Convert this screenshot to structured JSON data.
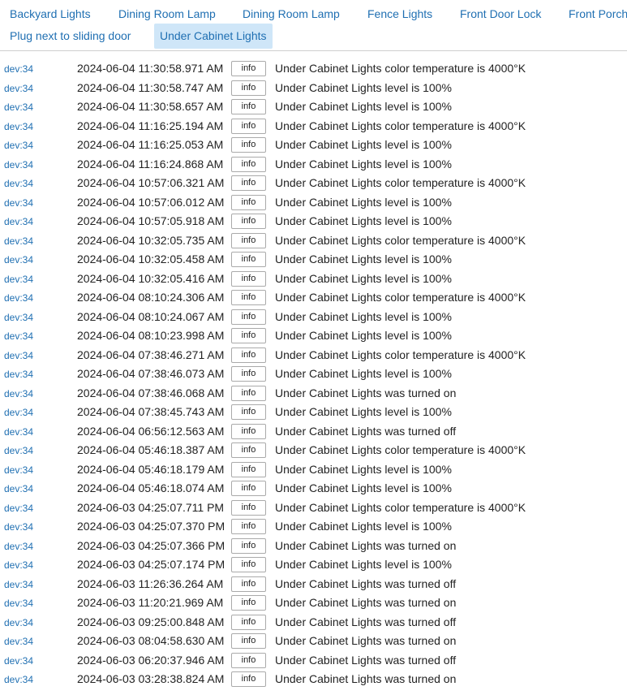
{
  "tabs": [
    {
      "label": "Backyard Lights",
      "active": false
    },
    {
      "label": "Dining Room Lamp",
      "active": false
    },
    {
      "label": "Dining Room Lamp",
      "active": false
    },
    {
      "label": "Fence Lights",
      "active": false
    },
    {
      "label": "Front Door Lock",
      "active": false
    },
    {
      "label": "Front Porch",
      "active": false
    },
    {
      "label": "Plug next to sliding door",
      "active": false
    },
    {
      "label": "Under Cabinet Lights",
      "active": true
    }
  ],
  "info_label": "info",
  "events": [
    {
      "dev": "dev:34",
      "time": "2024-06-04 11:30:58.971 AM",
      "desc": "Under Cabinet Lights color temperature is 4000°K"
    },
    {
      "dev": "dev:34",
      "time": "2024-06-04 11:30:58.747 AM",
      "desc": "Under Cabinet Lights level is 100%"
    },
    {
      "dev": "dev:34",
      "time": "2024-06-04 11:30:58.657 AM",
      "desc": "Under Cabinet Lights level is 100%"
    },
    {
      "dev": "dev:34",
      "time": "2024-06-04 11:16:25.194 AM",
      "desc": "Under Cabinet Lights color temperature is 4000°K"
    },
    {
      "dev": "dev:34",
      "time": "2024-06-04 11:16:25.053 AM",
      "desc": "Under Cabinet Lights level is 100%"
    },
    {
      "dev": "dev:34",
      "time": "2024-06-04 11:16:24.868 AM",
      "desc": "Under Cabinet Lights level is 100%"
    },
    {
      "dev": "dev:34",
      "time": "2024-06-04 10:57:06.321 AM",
      "desc": "Under Cabinet Lights color temperature is 4000°K"
    },
    {
      "dev": "dev:34",
      "time": "2024-06-04 10:57:06.012 AM",
      "desc": "Under Cabinet Lights level is 100%"
    },
    {
      "dev": "dev:34",
      "time": "2024-06-04 10:57:05.918 AM",
      "desc": "Under Cabinet Lights level is 100%"
    },
    {
      "dev": "dev:34",
      "time": "2024-06-04 10:32:05.735 AM",
      "desc": "Under Cabinet Lights color temperature is 4000°K"
    },
    {
      "dev": "dev:34",
      "time": "2024-06-04 10:32:05.458 AM",
      "desc": "Under Cabinet Lights level is 100%"
    },
    {
      "dev": "dev:34",
      "time": "2024-06-04 10:32:05.416 AM",
      "desc": "Under Cabinet Lights level is 100%"
    },
    {
      "dev": "dev:34",
      "time": "2024-06-04 08:10:24.306 AM",
      "desc": "Under Cabinet Lights color temperature is 4000°K"
    },
    {
      "dev": "dev:34",
      "time": "2024-06-04 08:10:24.067 AM",
      "desc": "Under Cabinet Lights level is 100%"
    },
    {
      "dev": "dev:34",
      "time": "2024-06-04 08:10:23.998 AM",
      "desc": "Under Cabinet Lights level is 100%"
    },
    {
      "dev": "dev:34",
      "time": "2024-06-04 07:38:46.271 AM",
      "desc": "Under Cabinet Lights color temperature is 4000°K"
    },
    {
      "dev": "dev:34",
      "time": "2024-06-04 07:38:46.073 AM",
      "desc": "Under Cabinet Lights level is 100%"
    },
    {
      "dev": "dev:34",
      "time": "2024-06-04 07:38:46.068 AM",
      "desc": "Under Cabinet Lights was turned on"
    },
    {
      "dev": "dev:34",
      "time": "2024-06-04 07:38:45.743 AM",
      "desc": "Under Cabinet Lights level is 100%"
    },
    {
      "dev": "dev:34",
      "time": "2024-06-04 06:56:12.563 AM",
      "desc": "Under Cabinet Lights was turned off"
    },
    {
      "dev": "dev:34",
      "time": "2024-06-04 05:46:18.387 AM",
      "desc": "Under Cabinet Lights color temperature is 4000°K"
    },
    {
      "dev": "dev:34",
      "time": "2024-06-04 05:46:18.179 AM",
      "desc": "Under Cabinet Lights level is 100%"
    },
    {
      "dev": "dev:34",
      "time": "2024-06-04 05:46:18.074 AM",
      "desc": "Under Cabinet Lights level is 100%"
    },
    {
      "dev": "dev:34",
      "time": "2024-06-03 04:25:07.711 PM",
      "desc": "Under Cabinet Lights color temperature is 4000°K"
    },
    {
      "dev": "dev:34",
      "time": "2024-06-03 04:25:07.370 PM",
      "desc": "Under Cabinet Lights level is 100%"
    },
    {
      "dev": "dev:34",
      "time": "2024-06-03 04:25:07.366 PM",
      "desc": "Under Cabinet Lights was turned on"
    },
    {
      "dev": "dev:34",
      "time": "2024-06-03 04:25:07.174 PM",
      "desc": "Under Cabinet Lights level is 100%"
    },
    {
      "dev": "dev:34",
      "time": "2024-06-03 11:26:36.264 AM",
      "desc": "Under Cabinet Lights was turned off"
    },
    {
      "dev": "dev:34",
      "time": "2024-06-03 11:20:21.969 AM",
      "desc": "Under Cabinet Lights was turned on"
    },
    {
      "dev": "dev:34",
      "time": "2024-06-03 09:25:00.848 AM",
      "desc": "Under Cabinet Lights was turned off"
    },
    {
      "dev": "dev:34",
      "time": "2024-06-03 08:04:58.630 AM",
      "desc": "Under Cabinet Lights was turned on"
    },
    {
      "dev": "dev:34",
      "time": "2024-06-03 06:20:37.946 AM",
      "desc": "Under Cabinet Lights was turned off"
    },
    {
      "dev": "dev:34",
      "time": "2024-06-03 03:28:38.824 AM",
      "desc": "Under Cabinet Lights was turned on"
    }
  ]
}
